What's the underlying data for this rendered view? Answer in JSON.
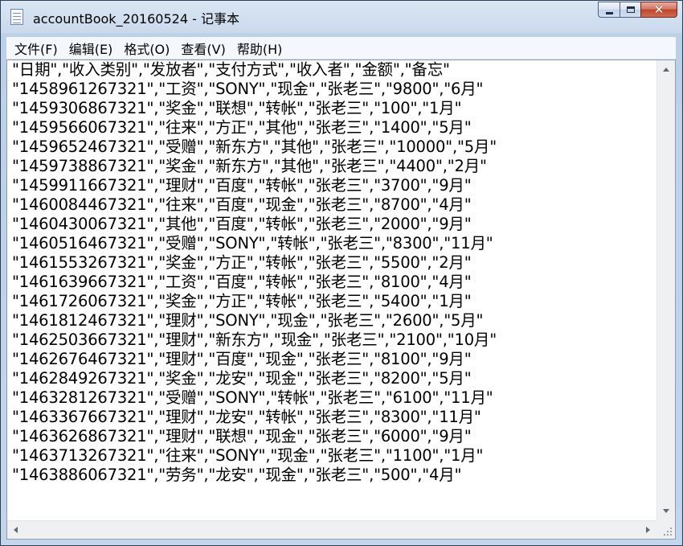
{
  "window": {
    "title": "accountBook_20160524 - 记事本",
    "icon": "notepad-icon",
    "controls": {
      "minimize": "minimize-icon",
      "maximize": "maximize-icon",
      "close": "close-icon"
    }
  },
  "menu": {
    "items": [
      "文件(F)",
      "编辑(E)",
      "格式(O)",
      "查看(V)",
      "帮助(H)"
    ]
  },
  "document": {
    "lines": [
      "\"日期\",\"收入类别\",\"发放者\",\"支付方式\",\"收入者\",\"金额\",\"备忘\"",
      "\"1458961267321\",\"工资\",\"SONY\",\"现金\",\"张老三\",\"9800\",\"6月\"",
      "\"1459306867321\",\"奖金\",\"联想\",\"转帐\",\"张老三\",\"100\",\"1月\"",
      "\"1459566067321\",\"往来\",\"方正\",\"其他\",\"张老三\",\"1400\",\"5月\"",
      "\"1459652467321\",\"受赠\",\"新东方\",\"其他\",\"张老三\",\"10000\",\"5月\"",
      "\"1459738867321\",\"奖金\",\"新东方\",\"其他\",\"张老三\",\"4400\",\"2月\"",
      "\"1459911667321\",\"理财\",\"百度\",\"转帐\",\"张老三\",\"3700\",\"9月\"",
      "\"1460084467321\",\"往来\",\"百度\",\"现金\",\"张老三\",\"8700\",\"4月\"",
      "\"1460430067321\",\"其他\",\"百度\",\"转帐\",\"张老三\",\"2000\",\"9月\"",
      "\"1460516467321\",\"受赠\",\"SONY\",\"转帐\",\"张老三\",\"8300\",\"11月\"",
      "\"1461553267321\",\"奖金\",\"方正\",\"转帐\",\"张老三\",\"5500\",\"2月\"",
      "\"1461639667321\",\"工资\",\"百度\",\"转帐\",\"张老三\",\"8100\",\"4月\"",
      "\"1461726067321\",\"奖金\",\"方正\",\"转帐\",\"张老三\",\"5400\",\"1月\"",
      "\"1461812467321\",\"理财\",\"SONY\",\"现金\",\"张老三\",\"2600\",\"5月\"",
      "\"1462503667321\",\"理财\",\"新东方\",\"现金\",\"张老三\",\"2100\",\"10月\"",
      "\"1462676467321\",\"理财\",\"百度\",\"现金\",\"张老三\",\"8100\",\"9月\"",
      "\"1462849267321\",\"奖金\",\"龙安\",\"现金\",\"张老三\",\"8200\",\"5月\"",
      "\"1463281267321\",\"受赠\",\"SONY\",\"转帐\",\"张老三\",\"6100\",\"11月\"",
      "\"1463367667321\",\"理财\",\"龙安\",\"转帐\",\"张老三\",\"8300\",\"11月\"",
      "\"1463626867321\",\"理财\",\"联想\",\"现金\",\"张老三\",\"6000\",\"9月\"",
      "\"1463713267321\",\"往来\",\"SONY\",\"现金\",\"张老三\",\"1100\",\"1月\"",
      "\"1463886067321\",\"劳务\",\"龙安\",\"现金\",\"张老三\",\"500\",\"4月\""
    ]
  }
}
